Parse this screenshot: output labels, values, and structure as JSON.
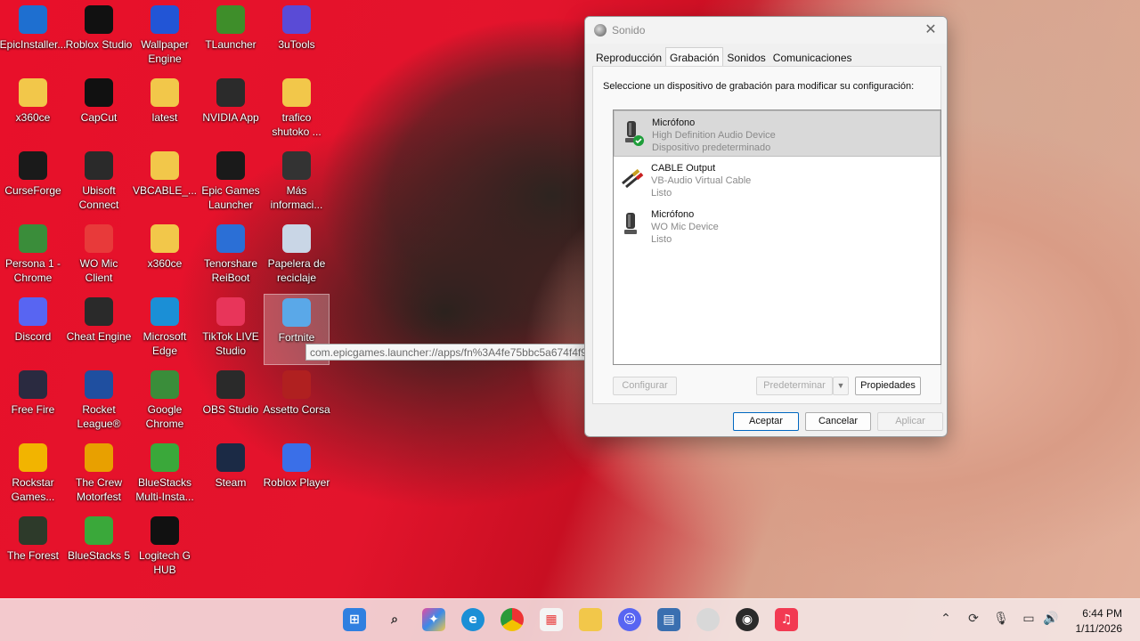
{
  "desktop": {
    "icons": [
      {
        "label": "EpicInstaller...",
        "icon": "epic-installer-icon",
        "color": "#1e6fd0"
      },
      {
        "label": "Roblox Studio",
        "icon": "roblox-studio-icon",
        "color": "#111111"
      },
      {
        "label": "Wallpaper Engine",
        "icon": "wallpaper-engine-icon",
        "color": "#2255d6"
      },
      {
        "label": "TLauncher",
        "icon": "tlauncher-icon",
        "color": "#3e8e2a"
      },
      {
        "label": "3uTools",
        "icon": "3utools-icon",
        "color": "#5a4bd6"
      },
      {
        "label": "x360ce",
        "icon": "folder-icon",
        "color": "#f2c74a"
      },
      {
        "label": "CapCut",
        "icon": "capcut-icon",
        "color": "#111111"
      },
      {
        "label": "latest",
        "icon": "folder-icon",
        "color": "#f2c74a"
      },
      {
        "label": "NVIDIA App",
        "icon": "nvidia-icon",
        "color": "#2b2b2b"
      },
      {
        "label": "trafico shutoko ...",
        "icon": "folder-icon",
        "color": "#f2c74a"
      },
      {
        "label": "CurseForge",
        "icon": "curseforge-icon",
        "color": "#1a1a1a"
      },
      {
        "label": "Ubisoft Connect",
        "icon": "ubisoft-icon",
        "color": "#2a2a2a"
      },
      {
        "label": "VBCABLE_...",
        "icon": "folder-icon",
        "color": "#f2c74a"
      },
      {
        "label": "Epic Games Launcher",
        "icon": "epic-games-icon",
        "color": "#1a1a1a"
      },
      {
        "label": "Más informaci...",
        "icon": "info-icon",
        "color": "#333333"
      },
      {
        "label": "Persona 1 - Chrome",
        "icon": "chrome-icon",
        "color": "#3a8d3a"
      },
      {
        "label": "WO Mic Client",
        "icon": "wo-mic-icon",
        "color": "#e83a3a"
      },
      {
        "label": "x360ce",
        "icon": "folder-icon",
        "color": "#f2c74a"
      },
      {
        "label": "Tenorshare ReiBoot",
        "icon": "reiboot-icon",
        "color": "#2b6fd6"
      },
      {
        "label": "Papelera de reciclaje",
        "icon": "recycle-bin-icon",
        "color": "#c9d6e6"
      },
      {
        "label": "Discord",
        "icon": "discord-icon",
        "color": "#5865f2"
      },
      {
        "label": "Cheat Engine",
        "icon": "cheat-engine-icon",
        "color": "#2a2a2a"
      },
      {
        "label": "Microsoft Edge",
        "icon": "edge-icon",
        "color": "#1b8fd6"
      },
      {
        "label": "TikTok LIVE Studio",
        "icon": "tiktok-icon",
        "color": "#e8355a"
      },
      {
        "label": "Fortnite",
        "icon": "fortnite-icon",
        "color": "#5aa8e8"
      },
      {
        "label": "Free Fire",
        "icon": "free-fire-icon",
        "color": "#2a2a40"
      },
      {
        "label": "Rocket League®",
        "icon": "rocket-league-icon",
        "color": "#1f4fa0"
      },
      {
        "label": "Google Chrome",
        "icon": "chrome-icon",
        "color": "#3a8d3a"
      },
      {
        "label": "OBS Studio",
        "icon": "obs-icon",
        "color": "#2a2a2a"
      },
      {
        "label": "Assetto Corsa",
        "icon": "assetto-corsa-icon",
        "color": "#b02020"
      },
      {
        "label": "Rockstar Games...",
        "icon": "rockstar-icon",
        "color": "#f2b400"
      },
      {
        "label": "The Crew Motorfest",
        "icon": "the-crew-icon",
        "color": "#e8a000"
      },
      {
        "label": "BlueStacks Multi-Insta...",
        "icon": "bluestacks-multi-icon",
        "color": "#3aa83a"
      },
      {
        "label": "Steam",
        "icon": "steam-icon",
        "color": "#1b2a45"
      },
      {
        "label": "Roblox Player",
        "icon": "roblox-player-icon",
        "color": "#3a6fe8"
      },
      {
        "label": "The Forest",
        "icon": "the-forest-icon",
        "color": "#2d3a2a"
      },
      {
        "label": "BlueStacks 5",
        "icon": "bluestacks-icon",
        "color": "#3aa83a"
      },
      {
        "label": "Logitech G HUB",
        "icon": "logitech-icon",
        "color": "#111111"
      }
    ],
    "tooltip": "com.epicgames.launcher://apps/fn%3A4fe75bbc5a674f4f9b356b5c90567da5%3AFortnite?..."
  },
  "dialog": {
    "title": "Sonido",
    "close": "✕",
    "tabs": [
      "Reproducción",
      "Grabación",
      "Sonidos",
      "Comunicaciones"
    ],
    "active_tab": "Grabación",
    "instruction": "Seleccione un dispositivo de grabación para modificar su configuración:",
    "devices": [
      {
        "name": "Micrófono",
        "desc": "High Definition Audio Device",
        "status": "Dispositivo predeterminado",
        "icon": "microphone-icon",
        "selected": true,
        "default": true
      },
      {
        "name": "CABLE Output",
        "desc": "VB-Audio Virtual Cable",
        "status": "Listo",
        "icon": "audio-cable-icon",
        "selected": false
      },
      {
        "name": "Micrófono",
        "desc": "WO Mic Device",
        "status": "Listo",
        "icon": "microphone-icon",
        "selected": false
      }
    ],
    "buttons": {
      "configure": "Configurar",
      "set_default": "Predeterminar",
      "properties": "Propiedades",
      "accept": "Aceptar",
      "cancel": "Cancelar",
      "apply": "Aplicar"
    }
  },
  "taskbar": {
    "time": "6:44 PM",
    "date": "1/11/2026"
  }
}
